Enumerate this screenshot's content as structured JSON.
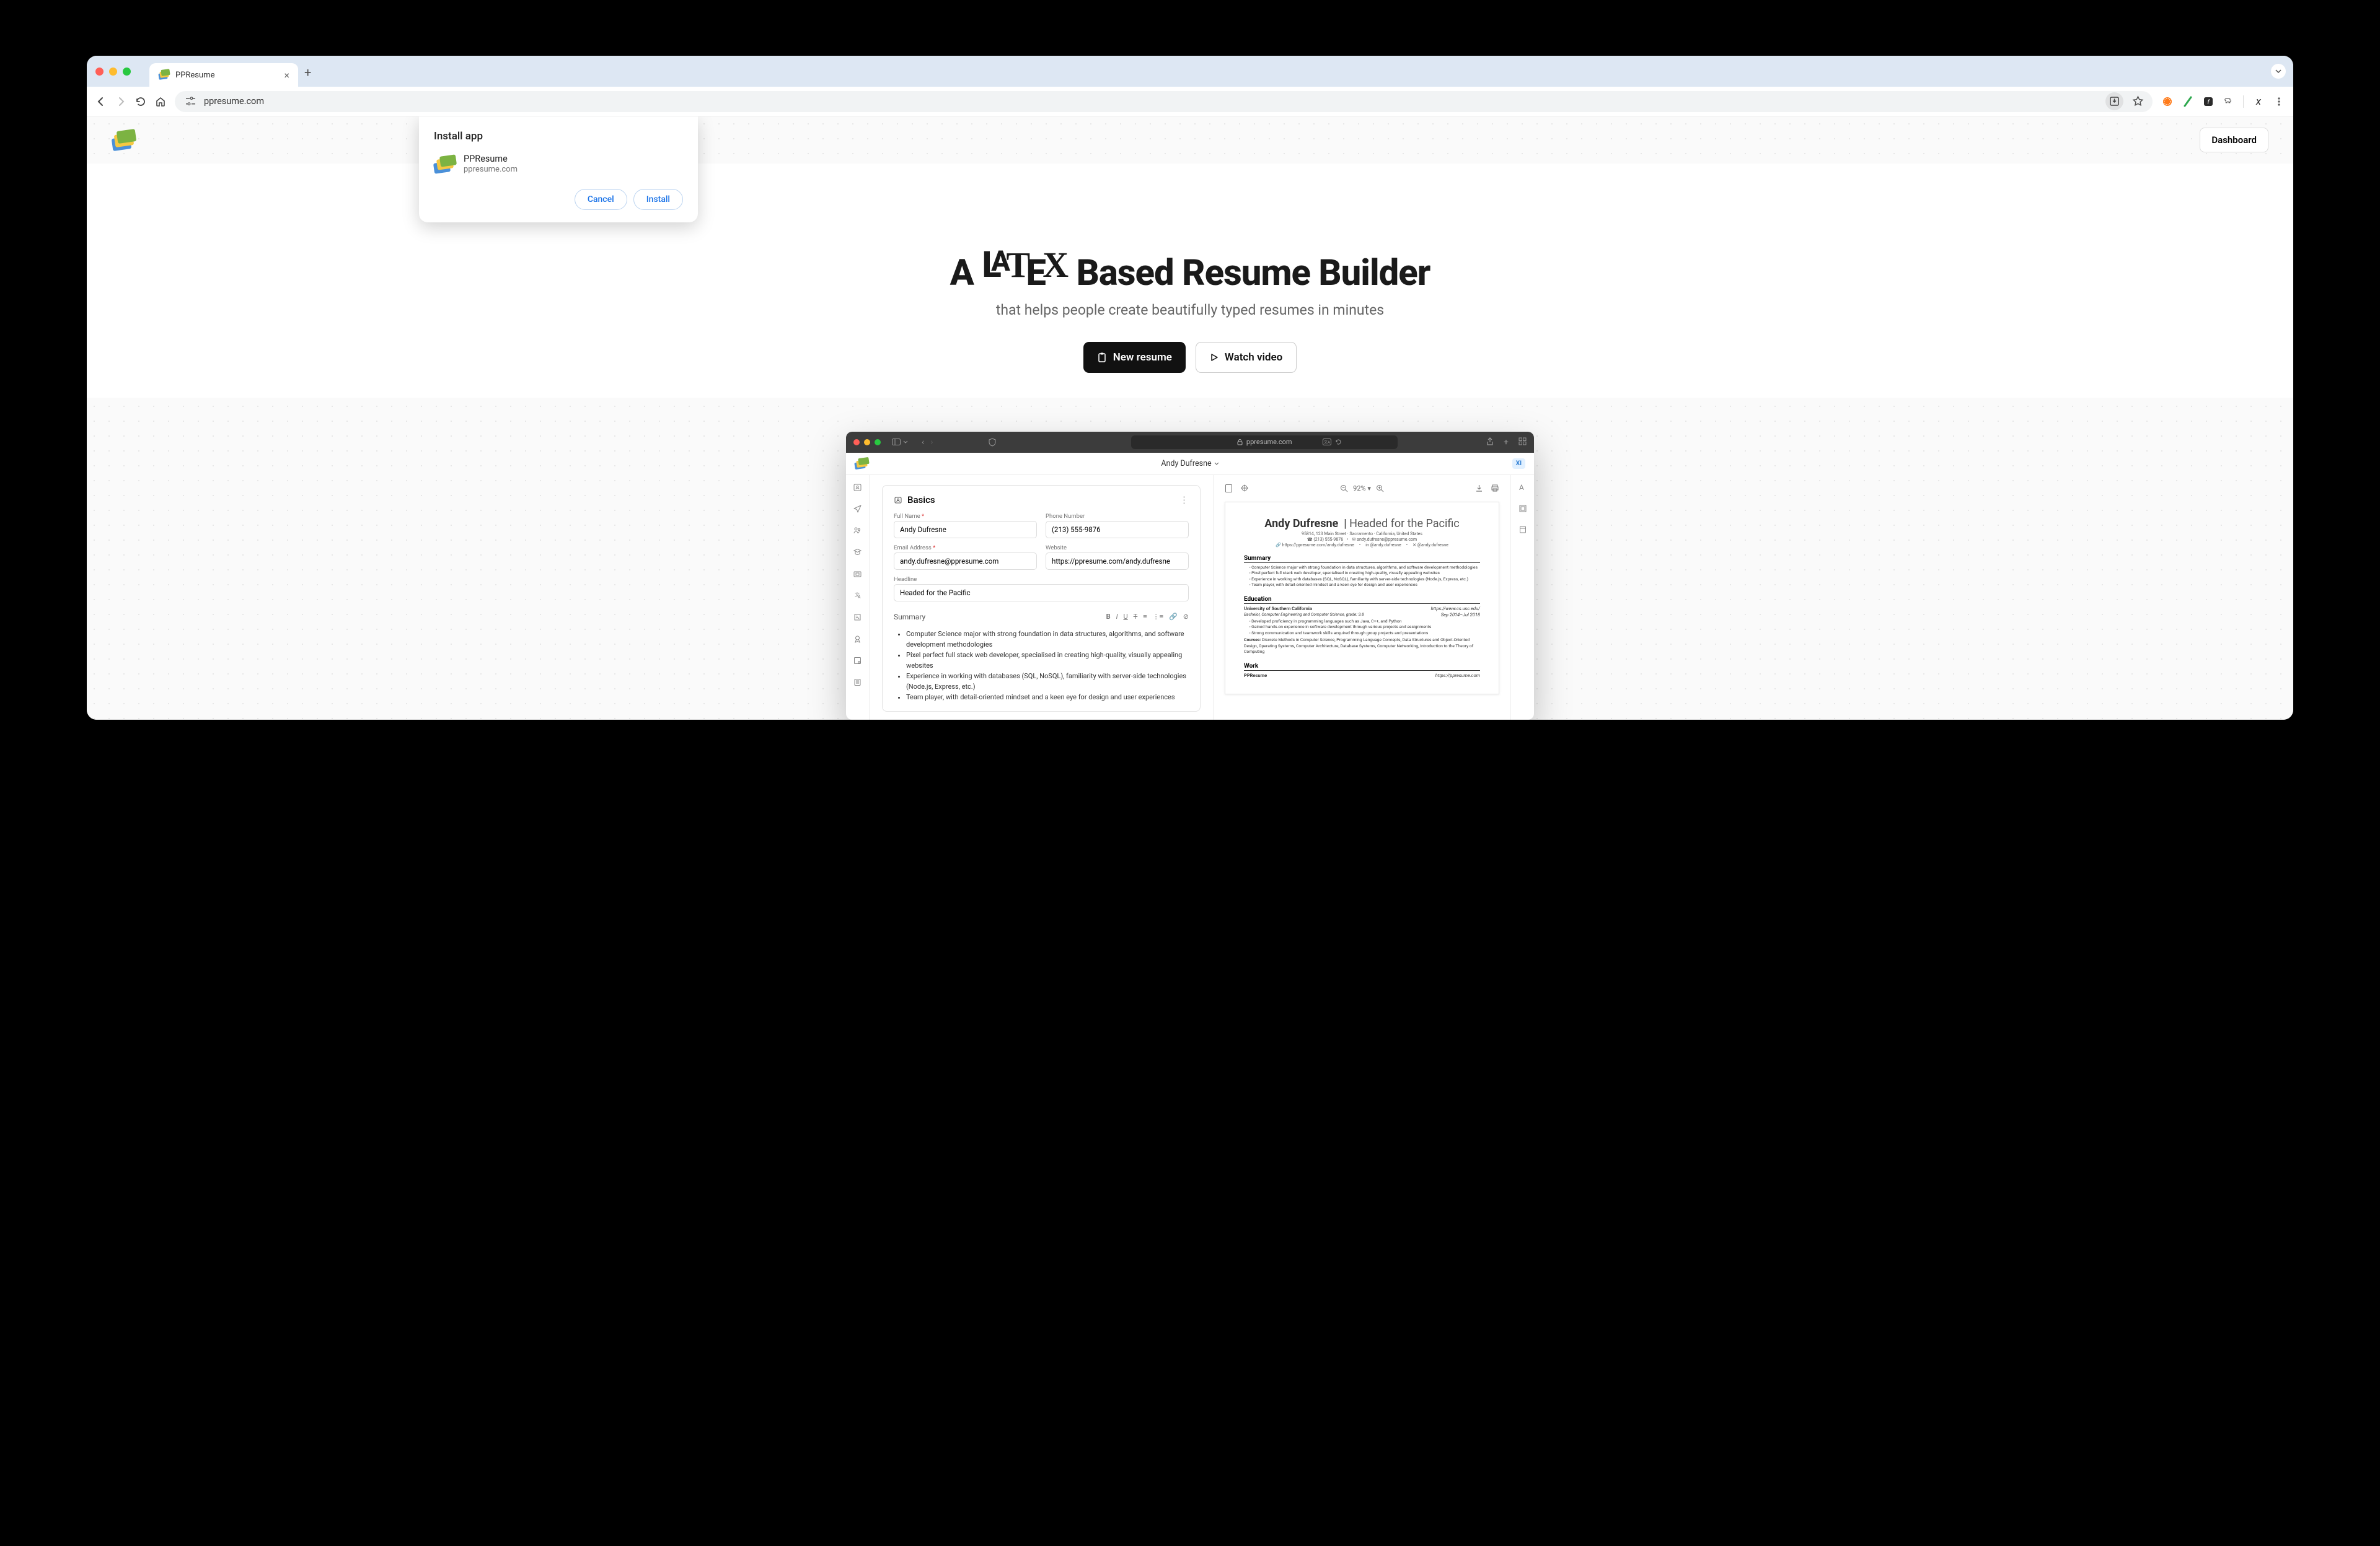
{
  "browser": {
    "tab_title": "PPResume",
    "url": "ppresume.com"
  },
  "install_popup": {
    "title": "Install app",
    "app_name": "PPResume",
    "app_domain": "ppresume.com",
    "cancel": "Cancel",
    "install": "Install"
  },
  "page": {
    "dashboard": "Dashboard",
    "hero_prefix": "A ",
    "hero_suffix": " Based Resume Builder",
    "hero_sub": "that helps people create beautifully typed resumes in minutes",
    "new_resume": "New resume",
    "watch_video": "Watch video"
  },
  "screenshot": {
    "url_host": "ppresume.com",
    "doc_title": "Andy Dufresne",
    "xi_badge": "XI",
    "basics_title": "Basics",
    "zoom": "92%",
    "fields": {
      "full_name_label": "Full Name",
      "full_name": "Andy Dufresne",
      "phone_label": "Phone Number",
      "phone": "(213) 555-9876",
      "email_label": "Email Address",
      "email": "andy.dufresne@ppresume.com",
      "website_label": "Website",
      "website": "https://ppresume.com/andy.dufresne",
      "headline_label": "Headline",
      "headline": "Headed for the Pacific",
      "summary_label": "Summary"
    },
    "summary_bullets": [
      "Computer Science major with strong foundation in data structures, algorithms, and software development methodologies",
      "Pixel perfect full stack web developer, specialised in creating high-quality, visually appealing websites",
      "Experience in working with databases (SQL, NoSQL), familiarity with server-side technologies (Node.js, Express, etc.)",
      "Team player, with detail-oriented mindset and a keen eye for design and user experiences"
    ],
    "preview": {
      "name": "Andy Dufresne",
      "headline": "Headed for the Pacific",
      "address": "95814, 123 Main Street · Sacramento · California, United States",
      "phone": "(213) 555-9876",
      "email": "andy.dufresne@ppresume.com",
      "link1": "https://ppresume.com/andy.dufresne",
      "link2": "@andy.dufresne",
      "link3": "@andy.dufresne",
      "sec_summary": "Summary",
      "summary_items": [
        "Computer Science major with strong foundation in data structures, algorithms, and software development methodologies",
        "Pixel perfect full stack web developer, specialised in creating high-quality, visually appealing websites",
        "Experience in working with databases (SQL, NoSQL), familiarity with server-side technologies (Node.js, Express, etc.)",
        "Team player, with detail-oriented mindset and a keen eye for design and user experiences"
      ],
      "sec_education": "Education",
      "edu_school": "University of Southern California",
      "edu_url": "https://www.cs.usc.edu/",
      "edu_degree": "Bachelor, Computer Engineering and Computer Science, grade: 3.8",
      "edu_dates": "Sep 2014–Jul 2018",
      "edu_items": [
        "Developed proficiency in programming languages such as Java, C++, and Python",
        "Gained hands-on experience in software development through various projects and assignments",
        "Strong communication and teamwork skills acquired through group projects and presentations"
      ],
      "edu_courses_label": "Courses:",
      "edu_courses": "Discrete Methods in Computer Science, Programming Language Concepts, Data Structures and Object-Oriented Design, Operating Systems, Computer Architecture, Database Systems, Computer Networking, Introduction to the Theory of Computing",
      "sec_work": "Work",
      "work_company": "PPResume",
      "work_url": "https://ppresume.com"
    }
  }
}
